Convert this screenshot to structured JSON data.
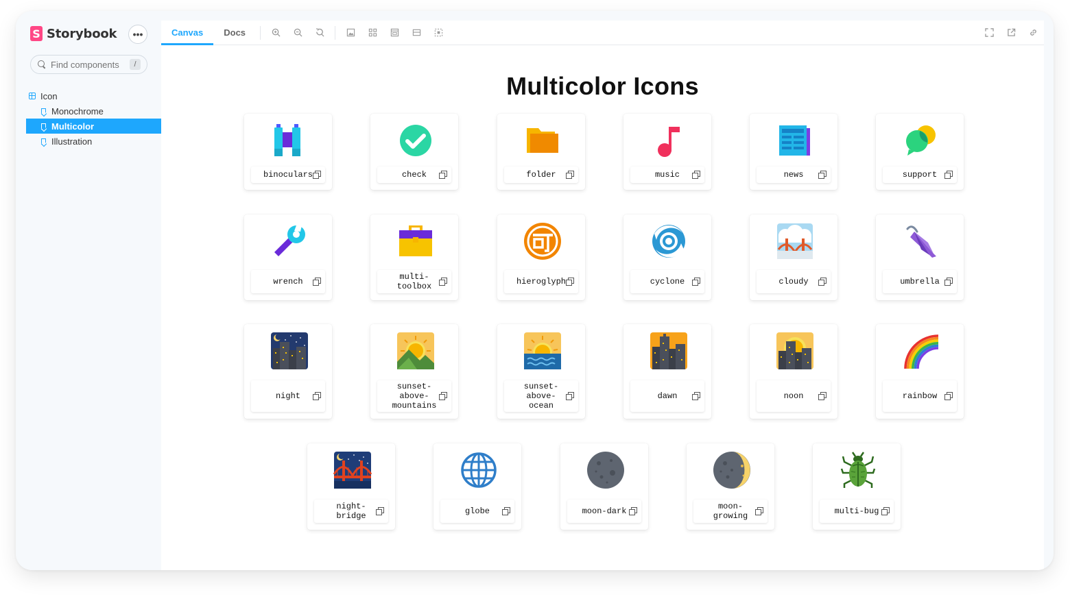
{
  "sidebar": {
    "brand": "Storybook",
    "search_placeholder": "Find components",
    "search_shortcut": "/",
    "tree": {
      "group": "Icon",
      "stories": [
        "Monochrome",
        "Multicolor",
        "Illustration"
      ],
      "active": "Multicolor"
    }
  },
  "toolbar": {
    "tabs": [
      "Canvas",
      "Docs"
    ]
  },
  "page": {
    "title": "Multicolor Icons"
  },
  "icons": [
    [
      "binoculars",
      "check",
      "folder",
      "music",
      "news",
      "support"
    ],
    [
      "wrench",
      "multi-toolbox",
      "hieroglyph",
      "cyclone",
      "cloudy",
      "umbrella"
    ],
    [
      "night",
      "sunset-above-mountains",
      "sunset-above-ocean",
      "dawn",
      "noon",
      "rainbow"
    ],
    [
      "night-bridge",
      "globe",
      "moon-dark",
      "moon-growing",
      "multi-bug"
    ]
  ]
}
